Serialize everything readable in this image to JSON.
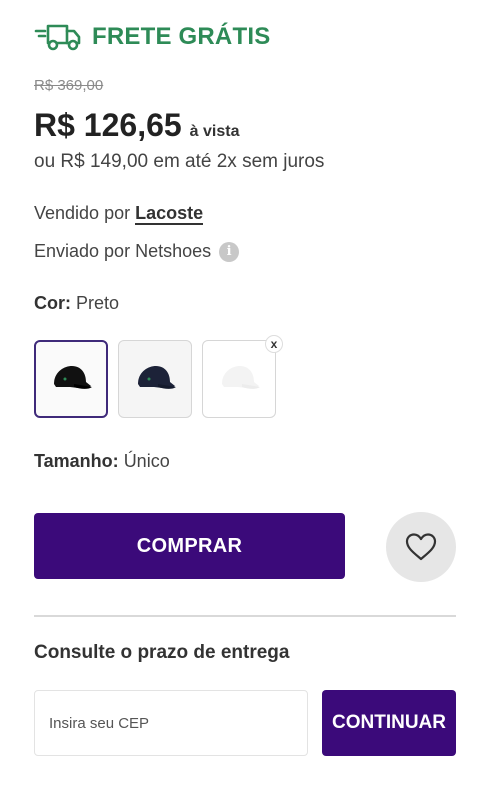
{
  "shipping": {
    "label": "FRETE GRÁTIS",
    "icon": "truck-icon",
    "color": "#2e8b57"
  },
  "pricing": {
    "old_price": "R$ 369,00",
    "price": "R$ 126,65",
    "price_note": "à vista",
    "installments": "ou R$ 149,00 em até 2x sem juros"
  },
  "seller": {
    "prefix": "Vendido por",
    "name": "Lacoste"
  },
  "fulfillment": {
    "label": "Enviado por Netshoes",
    "icon": "info-icon"
  },
  "color": {
    "label": "Cor:",
    "value": "Preto",
    "swatches": [
      {
        "name": "Preto",
        "fill": "#111111",
        "selected": true
      },
      {
        "name": "Azul Marinho",
        "fill": "#1c2238",
        "selected": false
      },
      {
        "name": "Branco",
        "fill": "#f3f3f3",
        "selected": false,
        "unavailable": true
      }
    ]
  },
  "size": {
    "label": "Tamanho:",
    "value": "Único"
  },
  "actions": {
    "buy_label": "COMPRAR",
    "favorite_icon": "heart-icon"
  },
  "delivery": {
    "title": "Consulte o prazo de entrega",
    "cep_placeholder": "Insira seu CEP",
    "cep_value": "",
    "continue_label": "CONTINUAR"
  },
  "colors": {
    "primary": "#3b0a7a",
    "success": "#2e8b57"
  }
}
